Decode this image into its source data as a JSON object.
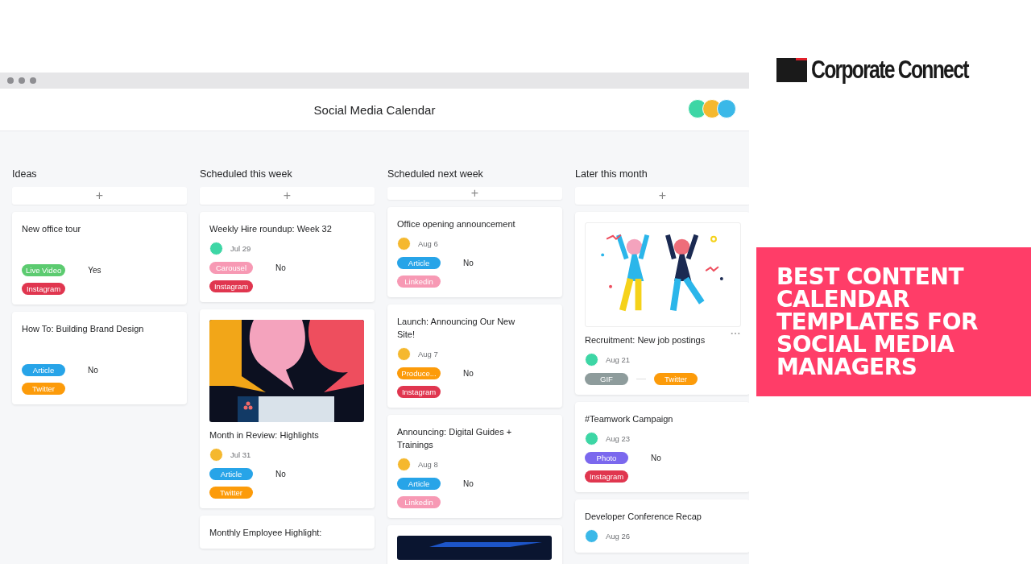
{
  "window": {
    "title": "Social Media Calendar"
  },
  "collaborators": [
    {
      "color": "#3dd6a5"
    },
    {
      "color": "#f5b82e"
    },
    {
      "color": "#3ab8e8"
    }
  ],
  "columns": [
    {
      "title": "Ideas",
      "add_button": "+",
      "cards": [
        {
          "kind": "text",
          "title": "New office tour",
          "format": {
            "label": "Live Video",
            "color": "#5ccb70"
          },
          "approval": "Yes",
          "channel": {
            "label": "Instagram",
            "color": "#e0364f"
          }
        },
        {
          "kind": "text",
          "title": "How To: Building Brand Design",
          "format": {
            "label": "Article",
            "color": "#27a4e8"
          },
          "approval": "No",
          "channel": {
            "label": "Twitter",
            "color": "#fc9b0a"
          }
        }
      ]
    },
    {
      "title": "Scheduled this week",
      "add_button": "+",
      "cards": [
        {
          "kind": "text",
          "title": "Weekly Hire roundup: Week 32",
          "avatar": {
            "color": "#3dd6a5"
          },
          "date": "Jul 29",
          "format": {
            "label": "Carousel",
            "color": "#f799b4"
          },
          "approval": "No",
          "channel": {
            "label": "Instagram",
            "color": "#e0364f"
          }
        },
        {
          "kind": "collage",
          "title": "Month in Review: Highlights",
          "avatar": {
            "color": "#f5b82e"
          },
          "date": "Jul 31",
          "format": {
            "label": "Article",
            "color": "#27a4e8"
          },
          "approval": "No",
          "channel": {
            "label": "Twitter",
            "color": "#fc9b0a"
          }
        },
        {
          "kind": "text",
          "title": "Monthly Employee Highlight:"
        }
      ]
    },
    {
      "title": "Scheduled next week",
      "add_button": "+",
      "cards": [
        {
          "kind": "text",
          "title": "Office opening announcement",
          "avatar": {
            "color": "#f5b82e"
          },
          "date": "Aug 6",
          "format": {
            "label": "Article",
            "color": "#27a4e8"
          },
          "approval": "No",
          "channel": {
            "label": "Linkedin",
            "color": "#f799b4"
          }
        },
        {
          "kind": "text",
          "title": "Launch: Announcing Our New Site!",
          "avatar": {
            "color": "#f5b82e"
          },
          "date": "Aug 7",
          "format": {
            "label": "Produce...",
            "color": "#fc9b0a"
          },
          "approval": "No",
          "channel": {
            "label": "Instagram",
            "color": "#e0364f"
          }
        },
        {
          "kind": "text",
          "title": "Announcing: Digital Guides + Trainings",
          "avatar": {
            "color": "#f5b82e"
          },
          "date": "Aug 8",
          "format": {
            "label": "Article",
            "color": "#27a4e8"
          },
          "approval": "No",
          "channel": {
            "label": "Linkedin",
            "color": "#f799b4"
          }
        },
        {
          "kind": "photo"
        }
      ]
    },
    {
      "title": "Later this month",
      "add_button": "+",
      "cards": [
        {
          "kind": "dancers",
          "title": "Recruitment: New job postings",
          "has_menu": true,
          "avatar": {
            "color": "#3dd6a5"
          },
          "date": "Aug 21",
          "tags_inline": true,
          "format": {
            "label": "GIF",
            "color": "#8e9c9c"
          },
          "channel": {
            "label": "Twitter",
            "color": "#fc9b0a"
          }
        },
        {
          "kind": "text",
          "title": "#Teamwork Campaign",
          "avatar": {
            "color": "#3dd6a5"
          },
          "date": "Aug 23",
          "format": {
            "label": "Photo",
            "color": "#7b68ee"
          },
          "approval": "No",
          "channel": {
            "label": "Instagram",
            "color": "#e0364f"
          }
        },
        {
          "kind": "text",
          "title": "Developer Conference Recap",
          "avatar": {
            "color": "#3ab8e8"
          },
          "date": "Aug 26"
        }
      ]
    }
  ],
  "brand": {
    "name": "Corporate Connect"
  },
  "banner": {
    "text": "BEST CONTENT CALENDAR TEMPLATES FOR SOCIAL MEDIA MANAGERS"
  }
}
